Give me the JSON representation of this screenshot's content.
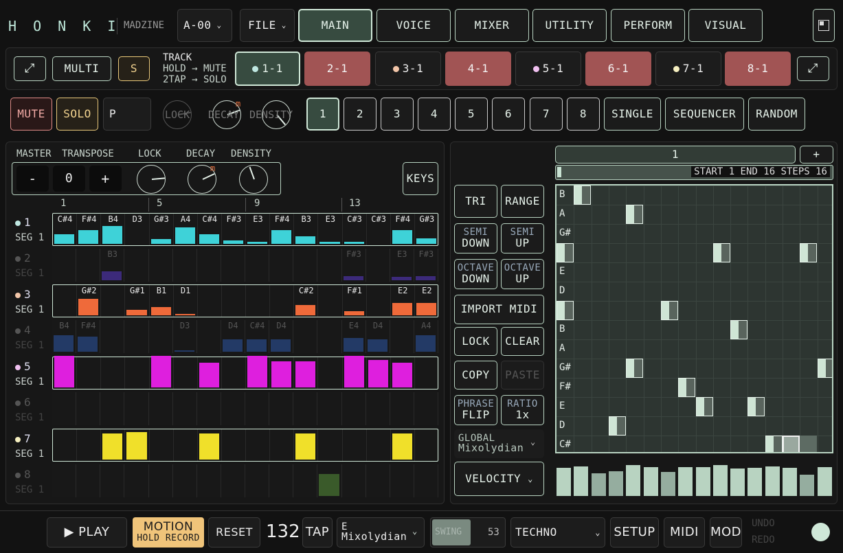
{
  "header": {
    "logo": "H O N K I",
    "madzine": "MADZINE",
    "preset": "A-00",
    "file": "FILE",
    "tabs": [
      "MAIN",
      "VOICE",
      "MIXER",
      "UTILITY",
      "PERFORM",
      "VISUAL"
    ]
  },
  "trackbar": {
    "multi": "MULTI",
    "s": "S",
    "track_title": "TRACK",
    "hold": "HOLD → MUTE",
    "tap": "2TAP → SOLO",
    "tracks": [
      "1-1",
      "2-1",
      "3-1",
      "4-1",
      "5-1",
      "6-1",
      "7-1",
      "8-1"
    ]
  },
  "row3": {
    "mute": "MUTE",
    "solo": "SOLO",
    "p": "P",
    "lock": "LOCK",
    "decay": "DECAY",
    "density": "DENSITY",
    "m": "m",
    "steps": [
      "1",
      "2",
      "3",
      "4",
      "5",
      "6",
      "7",
      "8"
    ],
    "single": "SINGLE",
    "sequencer": "SEQUENCER",
    "random": "RANDOM"
  },
  "left": {
    "master": "MASTER",
    "transpose": "TRANSPOSE",
    "lock": "LOCK",
    "decay": "DECAY",
    "density": "DENSITY",
    "minus": "-",
    "value": "0",
    "plus": "+",
    "keys": "KEYS",
    "m": "m",
    "ruler": [
      "1",
      "5",
      "9",
      "13"
    ],
    "seg": "SEG 1"
  },
  "tracks": [
    {
      "num": "1",
      "dot": "#bfe7e1",
      "notes": [
        "C#4",
        "F#4",
        "B4",
        "D3",
        "G#3",
        "A4",
        "C#4",
        "F#3",
        "E3",
        "F#4",
        "B3",
        "E3",
        "C#3",
        "C#3",
        "F#4",
        "G#3"
      ]
    },
    {
      "num": "2",
      "dot": "#555",
      "notes": [
        "",
        "",
        "B3",
        "",
        "",
        "",
        "",
        "",
        "",
        "",
        "",
        "",
        "F#3",
        "",
        "E3",
        "F#3"
      ]
    },
    {
      "num": "3",
      "dot": "#f2c5a8",
      "notes": [
        "",
        "G#2",
        "",
        "G#1",
        "B1",
        "D1",
        "",
        "",
        "",
        "",
        "C#2",
        "",
        "F#1",
        "",
        "E2",
        "E2"
      ]
    },
    {
      "num": "4",
      "dot": "#555",
      "notes": [
        "B4",
        "F#4",
        "",
        "",
        "",
        "D3",
        "",
        "D4",
        "C#4",
        "D4",
        "",
        "",
        "E4",
        "D4",
        "",
        "A4"
      ]
    },
    {
      "num": "5",
      "dot": "#f0c0f0",
      "notes": []
    },
    {
      "num": "6",
      "dot": "#555",
      "notes": []
    },
    {
      "num": "7",
      "dot": "#f5efc0",
      "notes": []
    },
    {
      "num": "8",
      "dot": "#555",
      "notes": []
    }
  ],
  "tools": {
    "tri": "TRI",
    "range": "RANGE",
    "semi_down": [
      "SEMI",
      "DOWN"
    ],
    "semi_up": [
      "SEMI",
      "UP"
    ],
    "oct_down": [
      "OCTAVE",
      "DOWN"
    ],
    "oct_up": [
      "OCTAVE",
      "UP"
    ],
    "import": "IMPORT MIDI",
    "lock": "LOCK",
    "clear": "CLEAR",
    "copy": "COPY",
    "paste": "PASTE",
    "phrase": [
      "PHRASE",
      "FLIP"
    ],
    "ratio": [
      "RATIO",
      "1x"
    ],
    "scale": [
      "GLOBAL",
      "Mixolydian"
    ],
    "velocity": "VELOCITY"
  },
  "seq": {
    "pattern": "1",
    "plus": "+",
    "range_text": "START 1 END 16 STEPS 16",
    "notes": [
      "B",
      "A",
      "G#",
      "F#",
      "E",
      "D",
      "C#",
      "B",
      "A",
      "G#",
      "F#",
      "E",
      "D",
      "C#"
    ]
  },
  "footer": {
    "play": "▶ PLAY",
    "motion": "MOTION",
    "hold_record": "HOLD RECORD",
    "reset": "RESET",
    "bpm": "132",
    "tap": "TAP",
    "key": "E",
    "mode": "Mixolydian",
    "swing": "SWING",
    "swing_val": "53",
    "genre": "TECHNO",
    "setup": "SETUP",
    "midi": "MIDI",
    "mod": "MOD",
    "undo": "UNDO",
    "redo": "REDO"
  }
}
